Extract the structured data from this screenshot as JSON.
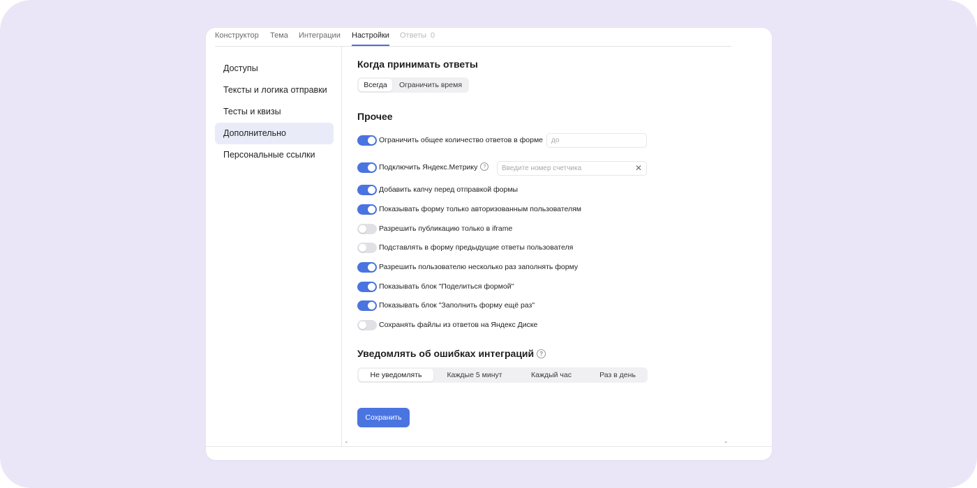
{
  "tabs": [
    {
      "label": "Конструктор"
    },
    {
      "label": "Тема"
    },
    {
      "label": "Интеграции"
    },
    {
      "label": "Настройки"
    },
    {
      "label": "Ответы",
      "count": "0"
    }
  ],
  "active_tab": "Настройки",
  "sidebar": {
    "items": [
      {
        "label": "Доступы"
      },
      {
        "label": "Тексты и логика отправки"
      },
      {
        "label": "Тесты и квизы"
      },
      {
        "label": "Дополнительно"
      },
      {
        "label": "Персональные ссылки"
      }
    ],
    "active": "Дополнительно"
  },
  "when_section": {
    "title": "Когда принимать ответы",
    "options": [
      "Всегда",
      "Ограничить время"
    ],
    "selected": "Всегда"
  },
  "other_section": {
    "title": "Прочее",
    "settings": [
      {
        "label": "Ограничить общее количество ответов в форме",
        "on": true
      },
      {
        "label": "Подключить Яндекс.Метрику",
        "on": true
      },
      {
        "label": "Добавить капчу перед отправкой формы",
        "on": true
      },
      {
        "label": "Показывать форму только авторизованным пользователям",
        "on": true
      },
      {
        "label": "Разрешить публикацию только в iframe",
        "on": false
      },
      {
        "label": "Подставлять в форму предыдущие ответы пользователя",
        "on": false
      },
      {
        "label": "Разрешить пользователю несколько раз заполнять форму",
        "on": true
      },
      {
        "label": "Показывать блок \"Поделиться формой\"",
        "on": true
      },
      {
        "label": "Показывать блок \"Заполнить форму ещё раз\"",
        "on": true
      },
      {
        "label": "Сохранять файлы из ответов на Яндекс Диске",
        "on": false
      }
    ],
    "limit_field": {
      "placeholder": "до",
      "value": ""
    },
    "metrika_field": {
      "placeholder": "Введите номер счетчика",
      "value": ""
    }
  },
  "notify_section": {
    "title": "Уведомлять об ошибках интеграций",
    "options": [
      "Не уведомлять",
      "Каждые 5 минут",
      "Каждый час",
      "Раз в день"
    ],
    "selected": "Не уведомлять"
  },
  "save_label": "Сохранить",
  "icons": {
    "help": "?",
    "clear": "✕",
    "scroll_left": "◂",
    "scroll_right": "▸"
  },
  "colors": {
    "accent": "#4a74e0",
    "tab_underline": "#4a6fd8",
    "active_sidebar_bg": "#e9ecf8",
    "background": "#ebe6f7"
  }
}
